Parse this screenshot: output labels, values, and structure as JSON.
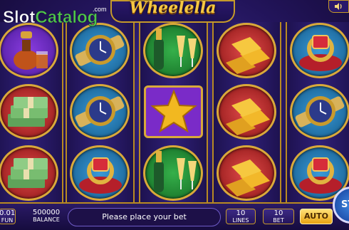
{
  "watermark": {
    "text": "SlotCatalog",
    "suffix": ".com"
  },
  "game": {
    "title": "Wheelella"
  },
  "controls": {
    "coin_value": "0.01",
    "coin_unit": "FUN",
    "balance_value": "500000",
    "balance_label": "BALANCE",
    "message": "Please place your bet",
    "lines_value": "10",
    "lines_label": "LINES",
    "bet_value": "10",
    "bet_label": "BET",
    "auto_label": "AUTO",
    "spin_label": "ST"
  },
  "icons": [
    "sound-icon"
  ],
  "reels": [
    [
      "cognac-and-whiskey",
      "money-stack",
      "money-stack"
    ],
    [
      "gold-watch",
      "gold-watch",
      "ruby-ring"
    ],
    [
      "champagne",
      "gold-star",
      "champagne"
    ],
    [
      "gold-bars",
      "gold-bars",
      "gold-bars"
    ],
    [
      "ruby-ring",
      "gold-watch",
      "ruby-ring"
    ]
  ],
  "colors": {
    "frame_gold": "#c59a2a",
    "title_gold": "#f5c842",
    "background": "#22145a",
    "auto_button": "#e8a312",
    "spin_button": "#2a62c4"
  }
}
